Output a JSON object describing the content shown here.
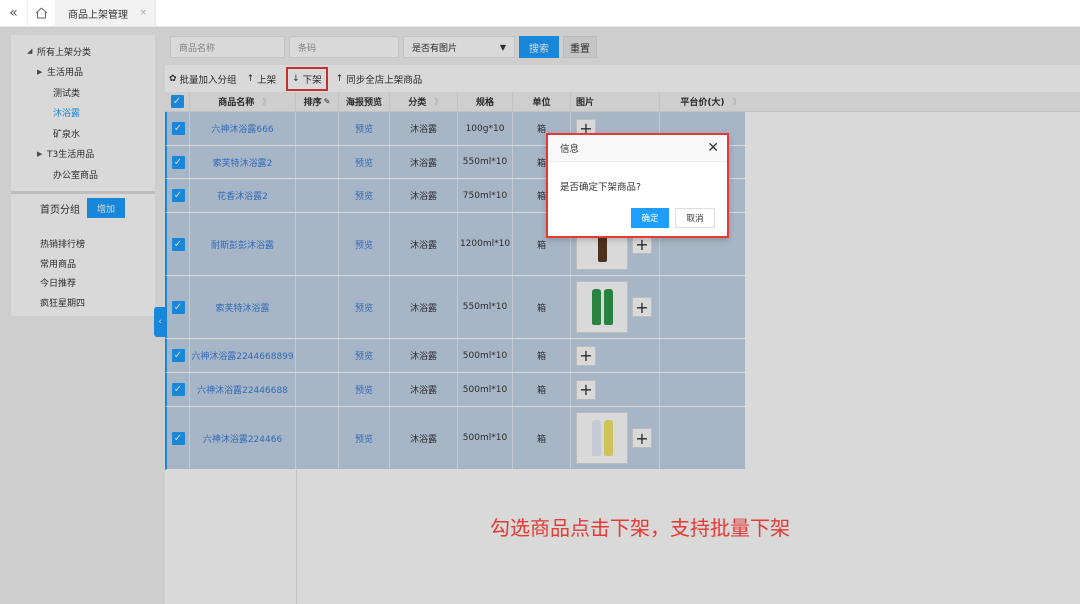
{
  "topbar": {
    "collapse_icon": "«",
    "home_icon": "home",
    "tab_label": "商品上架管理",
    "tab_close": "×"
  },
  "category_tree": {
    "items": [
      {
        "label": "所有上架分类",
        "arrow": "◢",
        "level": "lv1"
      },
      {
        "label": "生活用品",
        "arrow": "▶",
        "level": "lv2"
      },
      {
        "label": "测试类",
        "arrow": "",
        "level": "lv2n"
      },
      {
        "label": "沐浴露",
        "arrow": "",
        "level": "lv2n",
        "active": true
      },
      {
        "label": "矿泉水",
        "arrow": "",
        "level": "lv2n"
      },
      {
        "label": "T3生活用品",
        "arrow": "▶",
        "level": "lv2"
      },
      {
        "label": "办公室商品",
        "arrow": "",
        "level": "lv2n"
      }
    ]
  },
  "home_groups": {
    "title": "首页分组",
    "add_label": "增加",
    "items": [
      "热销排行榜",
      "常用商品",
      "今日推荐",
      "疯狂星期四"
    ]
  },
  "search": {
    "name_placeholder": "商品名称",
    "barcode_placeholder": "条码",
    "has_image_select": "是否有图片",
    "search_label": "搜索",
    "reset_label": "重置"
  },
  "toolbar": {
    "batch_group": "批量加入分组",
    "shelve": "上架",
    "unshelve": "下架",
    "sync": "同步全店上架商品"
  },
  "table": {
    "headers": {
      "name": "商品名称",
      "sort": "排序",
      "poster": "海报预览",
      "category": "分类",
      "spec": "规格",
      "unit": "单位",
      "image": "图片",
      "price": "平台价(大)"
    },
    "rows": [
      {
        "name": "六神沐浴露666",
        "preview": "预览",
        "category": "沐浴露",
        "spec": "100g*10",
        "unit": "箱"
      },
      {
        "name": "索芙特沐浴露2",
        "preview": "预览",
        "category": "沐浴露",
        "spec": "550ml*10",
        "unit": "箱"
      },
      {
        "name": "花香沐浴露2",
        "preview": "预览",
        "category": "沐浴露",
        "spec": "750ml*10",
        "unit": "箱"
      },
      {
        "name": "耐斯彭彭沐浴露",
        "preview": "预览",
        "category": "沐浴露",
        "spec": "1200ml*10",
        "unit": "箱"
      },
      {
        "name": "索芙特沐浴露",
        "preview": "预览",
        "category": "沐浴露",
        "spec": "550ml*10",
        "unit": "箱"
      },
      {
        "name": "六神沐浴露2244668899",
        "preview": "预览",
        "category": "沐浴露",
        "spec": "500ml*10",
        "unit": "箱"
      },
      {
        "name": "六神沐浴露22446688",
        "preview": "预览",
        "category": "沐浴露",
        "spec": "500ml*10",
        "unit": "箱"
      },
      {
        "name": "六神沐浴露224466",
        "preview": "预览",
        "category": "沐浴露",
        "spec": "500ml*10",
        "unit": "箱"
      }
    ]
  },
  "dialog": {
    "title": "信息",
    "message": "是否确定下架商品?",
    "ok_label": "确定",
    "cancel_label": "取消"
  },
  "caption": "勾选商品点击下架，支持批量下架",
  "colors": {
    "primary": "#1E9FFF",
    "highlight": "#e53935",
    "row_selected": "#c5d6ea"
  }
}
